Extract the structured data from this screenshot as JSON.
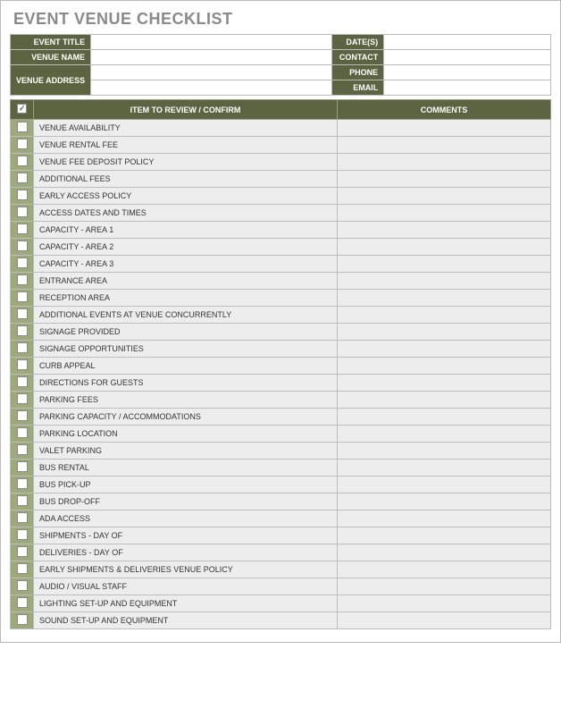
{
  "title": "EVENT VENUE CHECKLIST",
  "meta": {
    "event_title_label": "EVENT TITLE",
    "event_title": "",
    "venue_name_label": "VENUE NAME",
    "venue_name": "",
    "venue_address_label": "VENUE ADDRESS",
    "venue_address1": "",
    "venue_address2": "",
    "dates_label": "DATE(S)",
    "dates": "",
    "contact_label": "CONTACT",
    "contact": "",
    "phone_label": "PHONE",
    "phone": "",
    "email_label": "EMAIL",
    "email": ""
  },
  "headers": {
    "item": "ITEM TO REVIEW / CONFIRM",
    "comments": "COMMENTS"
  },
  "rows": [
    {
      "item": "VENUE AVAILABILITY",
      "comment": ""
    },
    {
      "item": "VENUE RENTAL FEE",
      "comment": ""
    },
    {
      "item": "VENUE FEE DEPOSIT POLICY",
      "comment": ""
    },
    {
      "item": "ADDITIONAL FEES",
      "comment": ""
    },
    {
      "item": "EARLY ACCESS POLICY",
      "comment": ""
    },
    {
      "item": "ACCESS DATES AND TIMES",
      "comment": ""
    },
    {
      "item": "CAPACITY - AREA 1",
      "comment": ""
    },
    {
      "item": "CAPACITY - AREA 2",
      "comment": ""
    },
    {
      "item": "CAPACITY - AREA 3",
      "comment": ""
    },
    {
      "item": "ENTRANCE AREA",
      "comment": ""
    },
    {
      "item": "RECEPTION AREA",
      "comment": ""
    },
    {
      "item": "ADDITIONAL EVENTS AT VENUE CONCURRENTLY",
      "comment": ""
    },
    {
      "item": "SIGNAGE PROVIDED",
      "comment": ""
    },
    {
      "item": "SIGNAGE OPPORTUNITIES",
      "comment": ""
    },
    {
      "item": "CURB APPEAL",
      "comment": ""
    },
    {
      "item": "DIRECTIONS FOR GUESTS",
      "comment": ""
    },
    {
      "item": "PARKING FEES",
      "comment": ""
    },
    {
      "item": "PARKING CAPACITY / ACCOMMODATIONS",
      "comment": ""
    },
    {
      "item": "PARKING LOCATION",
      "comment": ""
    },
    {
      "item": "VALET PARKING",
      "comment": ""
    },
    {
      "item": "BUS RENTAL",
      "comment": ""
    },
    {
      "item": "BUS PICK-UP",
      "comment": ""
    },
    {
      "item": "BUS DROP-OFF",
      "comment": ""
    },
    {
      "item": "ADA ACCESS",
      "comment": ""
    },
    {
      "item": "SHIPMENTS - DAY OF",
      "comment": ""
    },
    {
      "item": "DELIVERIES - DAY OF",
      "comment": ""
    },
    {
      "item": "EARLY SHIPMENTS & DELIVERIES VENUE POLICY",
      "comment": ""
    },
    {
      "item": "AUDIO / VISUAL STAFF",
      "comment": ""
    },
    {
      "item": "LIGHTING SET-UP  AND EQUIPMENT",
      "comment": ""
    },
    {
      "item": "SOUND SET-UP AND EQUIPMENT",
      "comment": ""
    }
  ]
}
